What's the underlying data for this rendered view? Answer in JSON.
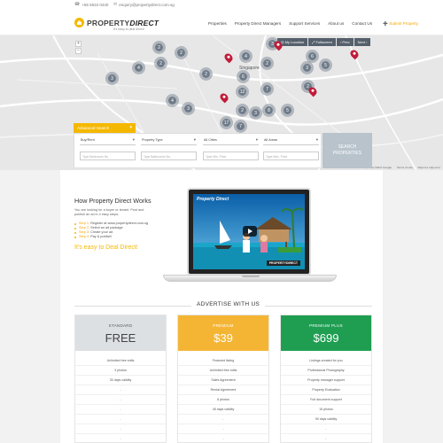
{
  "topbar": {
    "phone": "+65 6634 0440",
    "email": "enquiry@propertydirect.com.sg"
  },
  "brand": {
    "name_a": "PROPERTY",
    "name_b": "DIRECT",
    "tagline": "It's easy to deal direct!"
  },
  "nav": {
    "items": [
      "Properties",
      "Property Direct Managers",
      "Support Services",
      "About us",
      "Contact Us"
    ],
    "submit": "Submit Property"
  },
  "map": {
    "city_label": "Singapore",
    "controls": {
      "zoom_in": "+",
      "zoom_out": "−"
    },
    "bar": [
      "◎ My Location",
      "⤢ Fullscreen",
      "‹ Prev",
      "Next ›"
    ],
    "credits": [
      "Map data ©2017 Google",
      "Terms of Use",
      "Report a map error"
    ],
    "clusters": [
      "2",
      "2",
      "2",
      "4",
      "3",
      "2",
      "4",
      "3",
      "2",
      "6",
      "5",
      "3",
      "6",
      "7",
      "12",
      "2",
      "4",
      "2",
      "3",
      "8",
      "5",
      "17",
      "7",
      "3"
    ]
  },
  "search": {
    "advanced_label": "Advanced Search",
    "selects": [
      "Buy/Rent",
      "Property Type",
      "All Cities",
      "All Areas"
    ],
    "inputs": [
      "Type Bedrooms No.",
      "Type Bathrooms No.",
      "Type Min. Price",
      "Type Max. Price"
    ],
    "button": [
      "SEARCH",
      "PROPERTIES"
    ]
  },
  "how": {
    "title": "How Property Direct Works",
    "intro": "You are looking for a buyer or tenant. Post and publish an ad in 4 easy steps:",
    "steps": [
      {
        "num": "Step 1:",
        "text": " Register at www.propertydirect.com.sg"
      },
      {
        "num": "Step 2:",
        "text": " Select an ad package"
      },
      {
        "num": "Step 3:",
        "text": " Create your ad"
      },
      {
        "num": "Step 4:",
        "text": " Pay & publish!"
      }
    ],
    "slogan": "It's easy to Deal Direct!"
  },
  "video": {
    "title": "Property Direct",
    "brand": "PROPERTYDIRECT"
  },
  "advertise": {
    "heading": "ADVERTISE WITH US"
  },
  "plans": [
    {
      "name": "STANDARD",
      "price": "FREE",
      "color": "#dde0e3",
      "features": [
        "Unlimited free edits",
        "3 photos",
        "30 days validity",
        "-",
        "-",
        "-",
        "-",
        "-",
        "-",
        "-"
      ]
    },
    {
      "name": "PREMIUM",
      "price": "$39",
      "color": "#f5b534",
      "features": [
        "Featured listing",
        "Unlimited free edits",
        "Sales Agreement",
        "Rental Agreement",
        "6 photos",
        "45 days validity",
        "-",
        "-",
        "-",
        "-"
      ]
    },
    {
      "name": "PREMIUM PLUS",
      "price": "$699",
      "color": "#1f9e52",
      "features": [
        "Listings created for you",
        "Professional Photography",
        "Property manager support",
        "Property Evaluation",
        "Full document support",
        "15 photos",
        "90 days validity",
        "-",
        "-",
        "-"
      ]
    }
  ]
}
